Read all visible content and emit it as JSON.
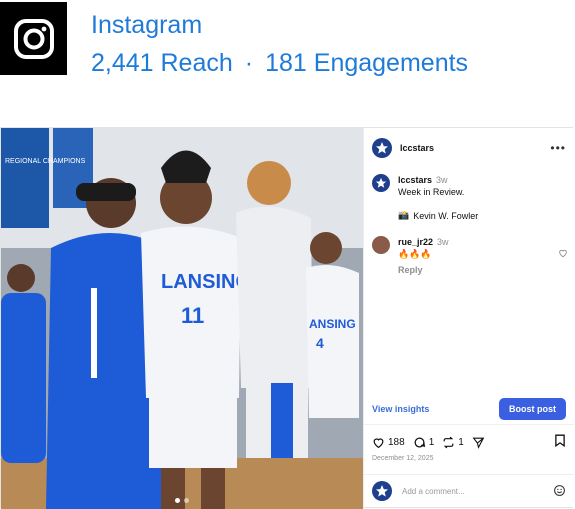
{
  "header": {
    "brand": "Instagram",
    "reach": "2,441 Reach",
    "separator": "·",
    "engagements": "181 Engagements"
  },
  "post": {
    "account": "lccstars",
    "more": "•••",
    "caption": {
      "username": "lccstars",
      "time": "3w",
      "text": "Week in Review."
    },
    "credit": {
      "icon": "camera-emoji",
      "text": "Kevin W. Fowler"
    },
    "comment": {
      "username": "rue_jr22",
      "time": "3w",
      "text": "🔥🔥🔥",
      "reply": "Reply"
    },
    "view_insights": "View insights",
    "boost": "Boost post",
    "likes": "188",
    "comments": "1",
    "reposts": "1",
    "date": "December 12, 2025",
    "comment_placeholder": "Add a comment...",
    "photo_text": {
      "jersey": "LANSING",
      "number": "11",
      "jersey2": "ANSING",
      "number2": "4",
      "banner1": "REGIONAL CHAMPIONS"
    }
  },
  "colors": {
    "accent": "#1f7bd8",
    "boost": "#3a5fe0",
    "team_blue": "#1e5bd6"
  }
}
